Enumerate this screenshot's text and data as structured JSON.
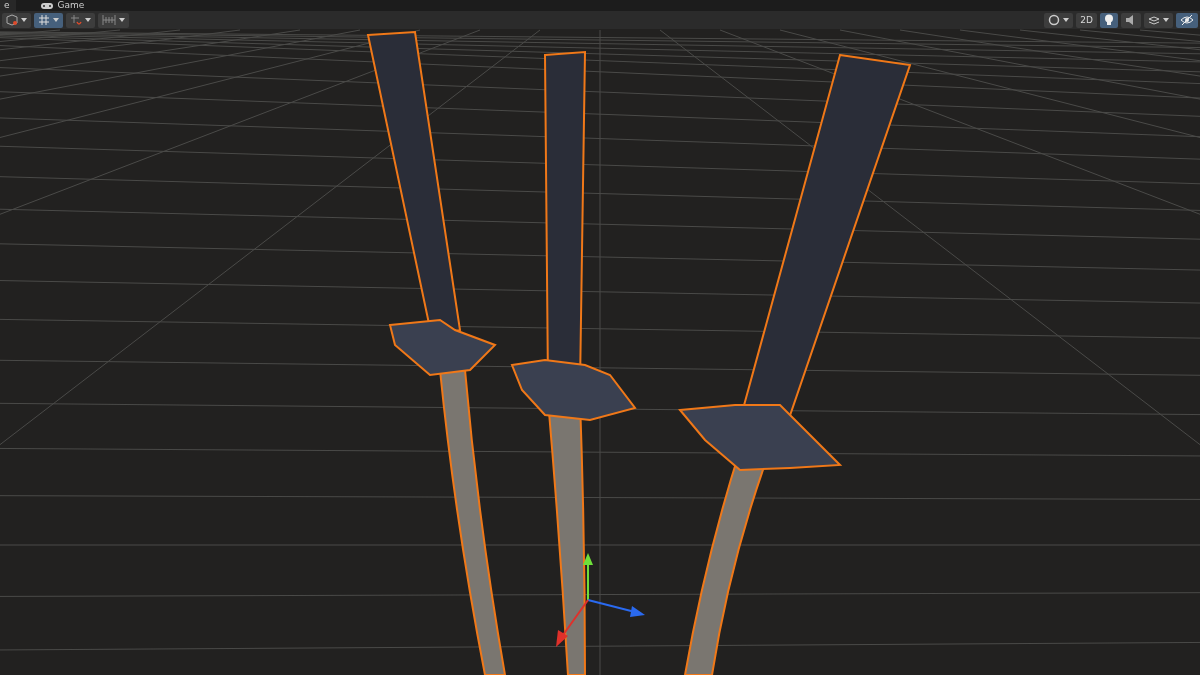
{
  "tabs": [
    {
      "label": "e",
      "icon": false,
      "selected": true
    },
    {
      "label": "Game",
      "icon": true,
      "selected": false
    }
  ],
  "toolbar": {
    "left": [
      {
        "kind": "cube",
        "selected": false,
        "dropdown": true
      },
      {
        "kind": "grid",
        "selected": true,
        "dropdown": true
      },
      {
        "kind": "snap",
        "selected": false,
        "dropdown": true
      },
      {
        "kind": "ruler",
        "selected": false,
        "dropdown": true
      }
    ],
    "right": [
      {
        "kind": "sphere",
        "selected": false,
        "dropdown": true
      },
      {
        "kind": "text",
        "label": "2D",
        "selected": false,
        "dropdown": false
      },
      {
        "kind": "bulb",
        "selected": true,
        "dropdown": false
      },
      {
        "kind": "speaker",
        "selected": false,
        "dropdown": false
      },
      {
        "kind": "layers",
        "selected": false,
        "dropdown": true
      },
      {
        "kind": "eye",
        "selected": true,
        "dropdown": false
      }
    ]
  }
}
